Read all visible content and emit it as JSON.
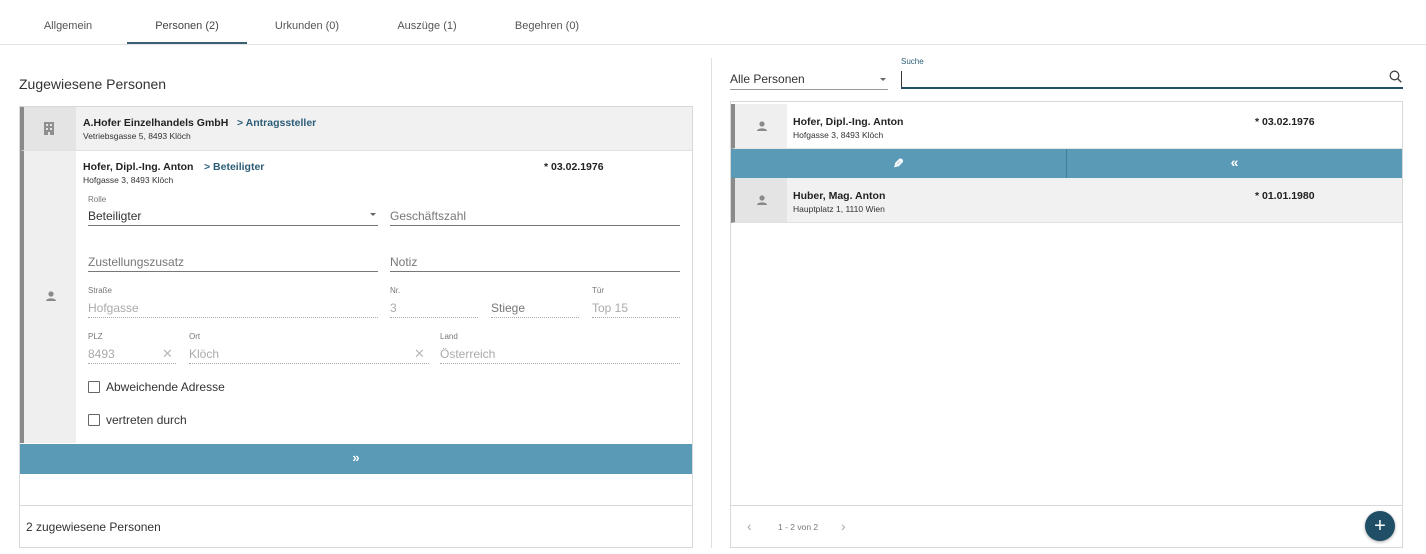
{
  "tabs": [
    {
      "label": "Allgemein"
    },
    {
      "label": "Personen (2)"
    },
    {
      "label": "Urkunden (0)"
    },
    {
      "label": "Auszüge (1)"
    },
    {
      "label": "Begehren (0)"
    }
  ],
  "left": {
    "title": "Zugewiesene Personen",
    "persons": [
      {
        "name": "A.Hofer Einzelhandels GmbH",
        "role_link": "> Antragssteller",
        "address": "Vetriebsgasse 5, 8493 Klöch",
        "icon": "building-icon"
      },
      {
        "name": "Hofer, Dipl.-Ing. Anton",
        "role_link": "> Beteiligter",
        "address": "Hofgasse 3, 8493 Klöch",
        "date": "* 03.02.1976",
        "icon": "person-icon"
      }
    ],
    "form": {
      "rolle_label": "Rolle",
      "rolle_value": "Beteiligter",
      "geschaeftszahl_placeholder": "Geschäftszahl",
      "zustellungszusatz_placeholder": "Zustellungszusatz",
      "notiz_placeholder": "Notiz",
      "strasse_label": "Straße",
      "strasse_value": "Hofgasse",
      "nr_label": "Nr.",
      "nr_value": "3",
      "stiege_placeholder": "Stiege",
      "tuer_label": "Tür",
      "tuer_value": "Top 15",
      "plz_label": "PLZ",
      "plz_value": "8493",
      "ort_label": "Ort",
      "ort_value": "Klöch",
      "land_label": "Land",
      "land_value": "Österreich",
      "abweichende_adresse": "Abweichende Adresse",
      "vertreten_durch": "vertreten durch"
    },
    "action_icon": "»",
    "footer": "2 zugewiesene Personen"
  },
  "right": {
    "filter_value": "Alle Personen",
    "search_label": "Suche",
    "results": [
      {
        "name": "Hofer, Dipl.-Ing. Anton",
        "address": "Hofgasse 3, 8493 Klöch",
        "date": "* 03.02.1976"
      },
      {
        "name": "Huber, Mag. Anton",
        "address": "Hauptplatz 1, 1110 Wien",
        "date": "* 01.01.1980"
      }
    ],
    "edit_icon": "✎",
    "move_left_icon": "«",
    "pagination": "1 - 2 von 2",
    "fab_icon": "+"
  },
  "colors": {
    "accent": "#5b9ab7",
    "dark": "#1f4e66",
    "link": "#2c5d78"
  }
}
